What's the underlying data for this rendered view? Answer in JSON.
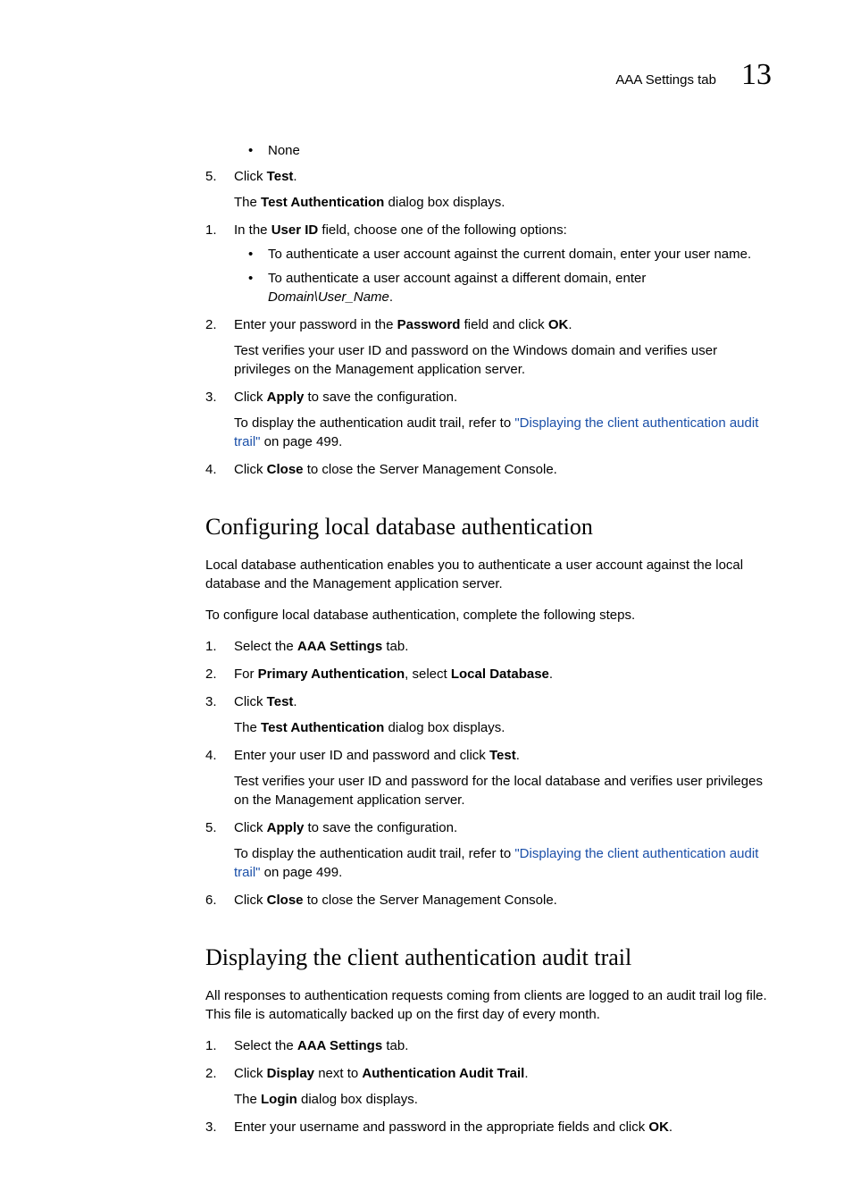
{
  "header": {
    "tab_label": "AAA Settings tab",
    "chapter_num": "13"
  },
  "top_block": {
    "bullet_none": "None",
    "step5_num": "5.",
    "step5_a": "Click ",
    "step5_b": "Test",
    "step5_c": ".",
    "step5_sub_a": "The ",
    "step5_sub_b": "Test Authentication",
    "step5_sub_c": " dialog box displays.",
    "s1_num": "1.",
    "s1_a": "In the ",
    "s1_b": "User ID",
    "s1_c": " field, choose one of the following options:",
    "s1_bul1": "To authenticate a user account against the current domain, enter your user name.",
    "s1_bul2_a": "To authenticate a user account against a different domain, enter ",
    "s1_bul2_b": "Domain\\User_Name",
    "s1_bul2_c": ".",
    "s2_num": "2.",
    "s2_a": "Enter your password in the ",
    "s2_b": "Password",
    "s2_c": " field and click ",
    "s2_d": "OK",
    "s2_e": ".",
    "s2_sub": "Test verifies your user ID and password on the Windows domain and verifies user privileges on the Management application server.",
    "s3_num": "3.",
    "s3_a": "Click ",
    "s3_b": "Apply",
    "s3_c": " to save the configuration.",
    "s3_sub_a": "To display the authentication audit trail, refer to ",
    "s3_link": "\"Displaying the client authentication audit trail\"",
    "s3_sub_b": " on page 499.",
    "s4_num": "4.",
    "s4_a": "Click ",
    "s4_b": "Close",
    "s4_c": " to close the Server Management Console."
  },
  "local_db": {
    "heading": "Configuring local database authentication",
    "intro": "Local database authentication enables you to authenticate a user account against the local database and the Management application server.",
    "intro2": "To configure local database authentication, complete the following steps.",
    "s1_num": "1.",
    "s1_a": "Select the ",
    "s1_b": "AAA Settings",
    "s1_c": " tab.",
    "s2_num": "2.",
    "s2_a": "For ",
    "s2_b": "Primary Authentication",
    "s2_c": ", select ",
    "s2_d": "Local Database",
    "s2_e": ".",
    "s3_num": "3.",
    "s3_a": "Click ",
    "s3_b": "Test",
    "s3_c": ".",
    "s3_sub_a": "The ",
    "s3_sub_b": "Test Authentication",
    "s3_sub_c": " dialog box displays.",
    "s4_num": "4.",
    "s4_a": "Enter your user ID and password and click ",
    "s4_b": "Test",
    "s4_c": ".",
    "s4_sub": "Test verifies your user ID and password for the local database and verifies user privileges on the Management application server.",
    "s5_num": "5.",
    "s5_a": "Click ",
    "s5_b": "Apply",
    "s5_c": " to save the configuration.",
    "s5_sub_a": "To display the authentication audit trail, refer to ",
    "s5_link": "\"Displaying the client authentication audit trail\"",
    "s5_sub_b": " on page 499.",
    "s6_num": "6.",
    "s6_a": "Click ",
    "s6_b": "Close",
    "s6_c": " to close the Server Management Console."
  },
  "audit": {
    "heading": "Displaying the client authentication audit trail",
    "intro": "All responses to authentication requests coming from clients are logged to an audit trail log file. This file is automatically backed up on the first day of every month.",
    "s1_num": "1.",
    "s1_a": "Select the ",
    "s1_b": "AAA Settings",
    "s1_c": " tab.",
    "s2_num": "2.",
    "s2_a": "Click ",
    "s2_b": "Display",
    "s2_c": " next to ",
    "s2_d": "Authentication Audit Trail",
    "s2_e": ".",
    "s2_sub_a": "The ",
    "s2_sub_b": "Login",
    "s2_sub_c": " dialog box displays.",
    "s3_num": "3.",
    "s3_a": "Enter your username and password in the appropriate fields and click ",
    "s3_b": "OK",
    "s3_c": "."
  }
}
